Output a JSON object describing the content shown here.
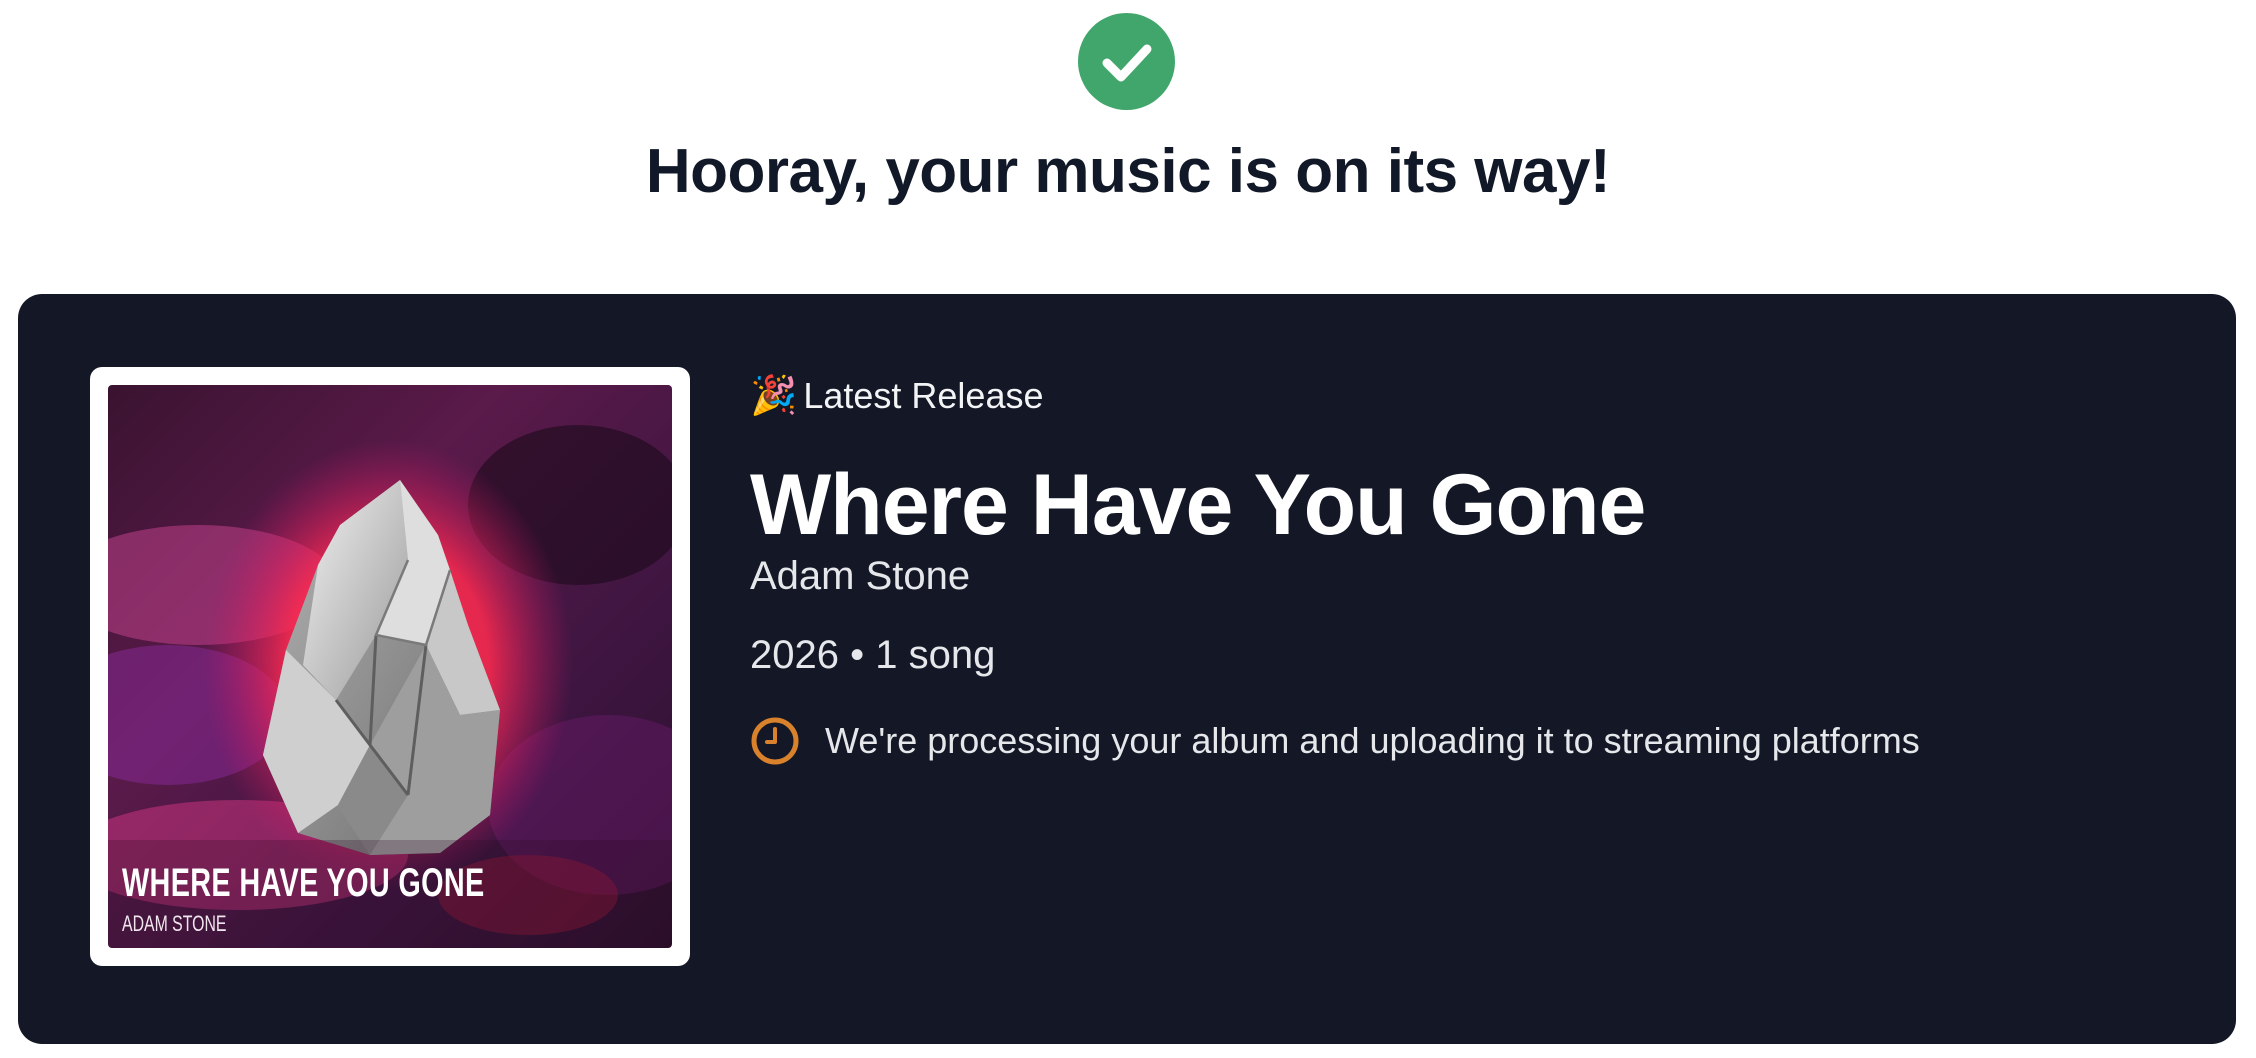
{
  "header": {
    "icon": "check-circle-icon",
    "success_color": "#41a66b",
    "title": "Hooray, your music is on its way!"
  },
  "release_card": {
    "background": "#141826",
    "eyebrow_icon": "party-popper-icon",
    "eyebrow_emoji": "🎉",
    "eyebrow_label": "Latest Release",
    "title": "Where Have You Gone",
    "artist": "Adam Stone",
    "meta": "2026 • 1 song",
    "status_icon": "clock-icon",
    "status_color": "#d9822b",
    "status_text": "We're processing your album and uploading it to streaming platforms",
    "cover": {
      "title": "WHERE HAVE YOU GONE",
      "artist": "ADAM STONE"
    }
  }
}
